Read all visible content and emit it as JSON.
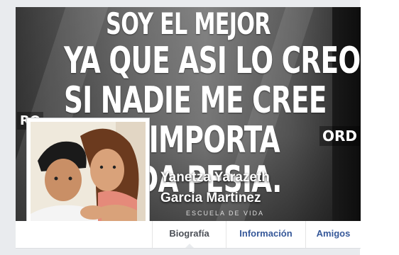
{
  "cover": {
    "lines": [
      "SOY EL MEJOR",
      "YA QUE ASI LO CREO YO.",
      "SI NADIE ME CREE",
      "ME IMPORTA",
      "NADA PESIA."
    ],
    "sign_left": "RO",
    "sign_right": "ORD",
    "bottom_caption": "ESCUELA DE VIDA"
  },
  "profile": {
    "name_line1": "Yanetza Yarazeth",
    "name_line2": "Garcia Martinez"
  },
  "tabs": [
    {
      "label": "Biografía",
      "active": true
    },
    {
      "label": "Información",
      "active": false
    },
    {
      "label": "Amigos",
      "active": false
    }
  ],
  "colors": {
    "page_bg": "#e9ebee",
    "link_blue": "#365899",
    "active_tab": "#4b4f56"
  }
}
